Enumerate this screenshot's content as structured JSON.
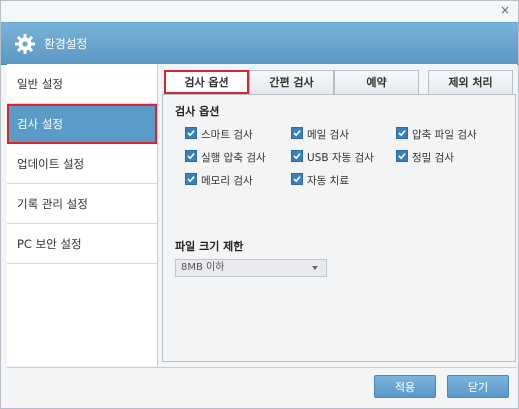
{
  "window": {
    "close_label": "×"
  },
  "header": {
    "title": "환경설정",
    "icon": "gear-icon"
  },
  "sidebar": {
    "items": [
      {
        "label": "일반 설정",
        "active": false
      },
      {
        "label": "검사 설정",
        "active": true
      },
      {
        "label": "업데이트 설정",
        "active": false
      },
      {
        "label": "기록 관리 설정",
        "active": false
      },
      {
        "label": "PC 보안 설정",
        "active": false
      }
    ]
  },
  "tabs": [
    {
      "label": "검사 옵션",
      "active": true
    },
    {
      "label": "간편 검사",
      "active": false
    },
    {
      "label": "예약",
      "active": false
    },
    {
      "label": "제외 처리",
      "active": false
    }
  ],
  "scan_options": {
    "title": "검사 옵션",
    "options": [
      {
        "label": "스마트 검사",
        "checked": true
      },
      {
        "label": "메일 검사",
        "checked": true
      },
      {
        "label": "압축 파일 검사",
        "checked": true
      },
      {
        "label": "실행 압축 검사",
        "checked": true
      },
      {
        "label": "USB 자동 검사",
        "checked": true
      },
      {
        "label": "정밀 검사",
        "checked": true
      },
      {
        "label": "메모리 검사",
        "checked": true
      },
      {
        "label": "자동 치료",
        "checked": true
      }
    ]
  },
  "file_size": {
    "title": "파일 크기 제한",
    "selected": "8MB 이하"
  },
  "footer": {
    "apply_label": "적용",
    "close_label": "닫기"
  },
  "colors": {
    "accent": "#5a9bc8",
    "highlight": "#d8262e",
    "checkbox": "#3b7fbd"
  }
}
